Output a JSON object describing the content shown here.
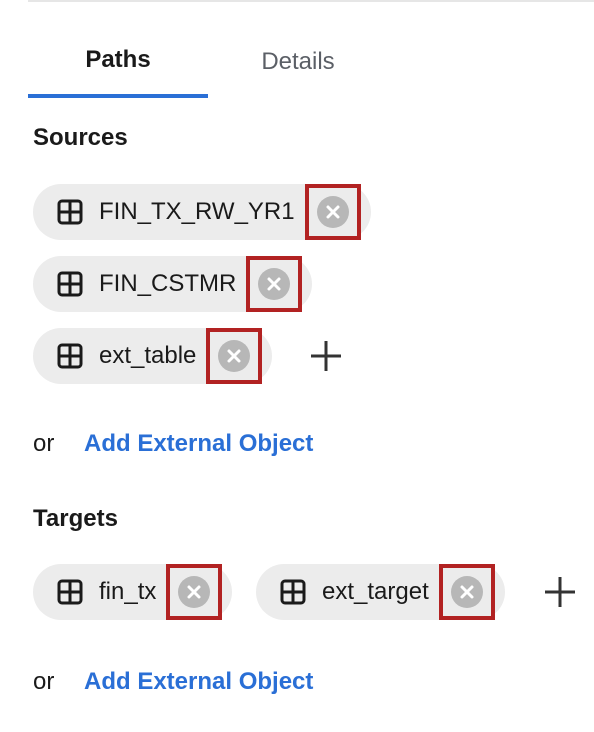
{
  "tabs": {
    "active": "Paths",
    "inactive": "Details"
  },
  "sources": {
    "title": "Sources",
    "items": [
      {
        "label": "FIN_TX_RW_YR1",
        "icon": "table-icon"
      },
      {
        "label": "FIN_CSTMR",
        "icon": "table-icon"
      },
      {
        "label": "ext_table",
        "icon": "table-icon"
      }
    ],
    "or_text": "or",
    "add_external": "Add External Object"
  },
  "targets": {
    "title": "Targets",
    "items": [
      {
        "label": "fin_tx",
        "icon": "table-icon"
      },
      {
        "label": "ext_target",
        "icon": "table-icon"
      }
    ],
    "or_text": "or",
    "add_external": "Add External Object"
  },
  "colors": {
    "accent": "#2a6fd6",
    "chip_bg": "#ececec",
    "remove_bg": "#b7b7b7",
    "highlight": "#b22222"
  }
}
